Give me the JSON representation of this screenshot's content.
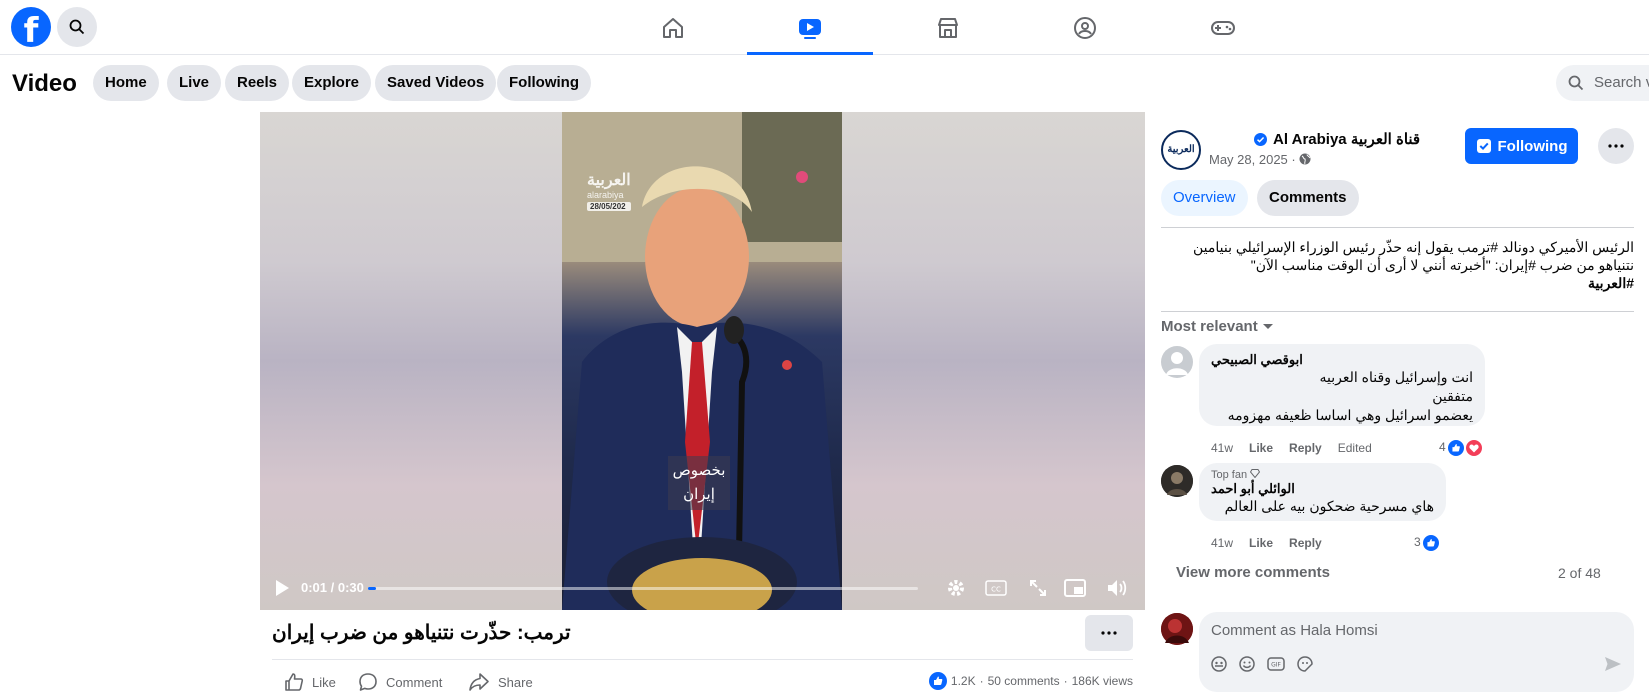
{
  "topbar": {
    "logo": "f",
    "nav": [
      "home-icon",
      "video-icon",
      "marketplace-icon",
      "groups-icon",
      "gaming-icon"
    ],
    "active_nav": "video-icon"
  },
  "subheader": {
    "title": "Video",
    "pills": [
      "Home",
      "Live",
      "Reels",
      "Explore",
      "Saved Videos",
      "Following"
    ],
    "search_placeholder": "Search vi"
  },
  "video": {
    "time": "0:01 / 0:30",
    "progress_fraction": 0.004,
    "watermark": "العربية",
    "watermark_sub": "alarabiya",
    "watermark_date": "28/05/202",
    "caption_line1": "بخصوص",
    "caption_line2": "إيران"
  },
  "post": {
    "title": "ترمب: حذّرت نتنياهو من ضرب إيران",
    "actions": {
      "like": "Like",
      "comment": "Comment",
      "share": "Share"
    },
    "reactions_count": "1.2K",
    "comments_count": "50 comments",
    "views": "186K views"
  },
  "right_panel": {
    "page_name": "Al Arabiya قناة العربية",
    "page_avatar_text": "العربية",
    "date": "May 28, 2025 ·",
    "follow_label": "Following",
    "tabs": [
      "Overview",
      "Comments"
    ],
    "description_line1": "الرئيس الأميركي دونالد #ترمب يقول إنه حذّر رئيس الوزراء الإسرائيلي بنيامين",
    "description_line2": "نتنياهو من ضرب #إيران: \"أخبرته أنني لا أرى أن الوقت مناسب الآن\"",
    "description_line3": "#العربية",
    "sort_label": "Most relevant",
    "comments": [
      {
        "name": "ابوقصي الصبيحي",
        "lines": [
          "انت وإسرائيل وقناه العربيه",
          "متفقين",
          "يعضمو اسرائيل وهي اساسا ظعيفه مهزومه"
        ],
        "age": "41w",
        "like": "Like",
        "reply": "Reply",
        "edited": "Edited",
        "reactions": "4"
      },
      {
        "badge": "Top fan",
        "name": "الوائلي أبو احمد",
        "lines": [
          "هاي مسرحية ضحكون بيه على العالم"
        ],
        "age": "41w",
        "like": "Like",
        "reply": "Reply",
        "reactions": "3"
      }
    ],
    "view_more": "View more comments",
    "count_label": "2 of 48",
    "composer_placeholder": "Comment as Hala Homsi"
  },
  "colors": {
    "brand": "#0866ff",
    "pill_bg": "#e4e6eb",
    "muted": "#65676b"
  }
}
